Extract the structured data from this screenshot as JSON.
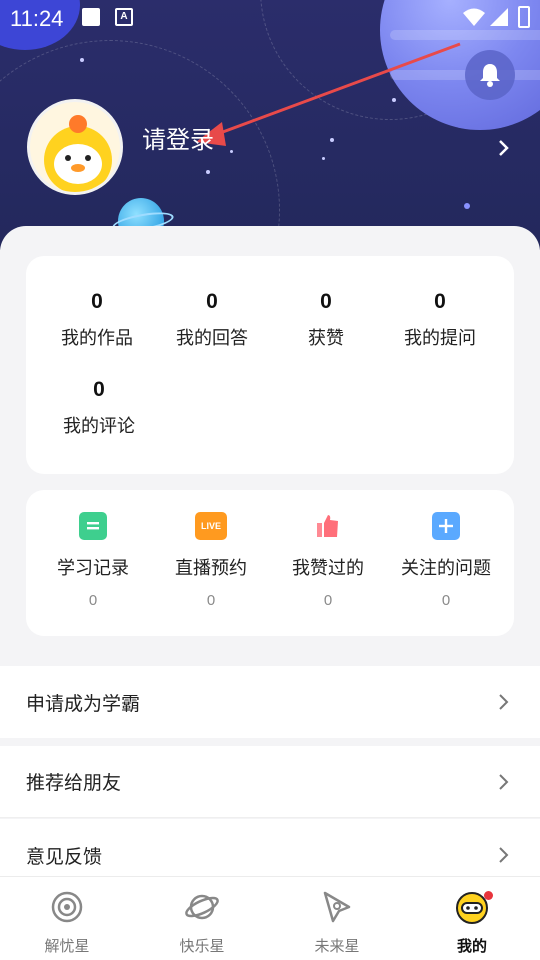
{
  "status_bar": {
    "time": "11:24",
    "badge_letter": "A"
  },
  "profile": {
    "login_text": "请登录"
  },
  "stats": [
    {
      "value": "0",
      "label": "我的作品"
    },
    {
      "value": "0",
      "label": "我的回答"
    },
    {
      "value": "0",
      "label": "获赞"
    },
    {
      "value": "0",
      "label": "我的提问"
    },
    {
      "value": "0",
      "label": "我的评论"
    }
  ],
  "shortcuts": [
    {
      "icon": "study-record-icon",
      "label": "学习记录",
      "count": "0",
      "color": "#3ecf8e"
    },
    {
      "icon": "live-reservation-icon",
      "label": "直播预约",
      "count": "0",
      "color": "#ff9a1f"
    },
    {
      "icon": "thumbs-up-icon",
      "label": "我赞过的",
      "count": "0",
      "color": "#ff6f7a"
    },
    {
      "icon": "plus-icon",
      "label": "关注的问题",
      "count": "0",
      "color": "#5aa9ff"
    }
  ],
  "shortcut_live_text": "LIVE",
  "menu": [
    {
      "label": "申请成为学霸"
    },
    {
      "label": "推荐给朋友"
    },
    {
      "label": "意见反馈"
    }
  ],
  "tabs": [
    {
      "label": "解忧星",
      "icon": "planet-spiral-icon",
      "active": false
    },
    {
      "label": "快乐星",
      "icon": "planet-ring-icon",
      "active": false
    },
    {
      "label": "未来星",
      "icon": "rocket-icon",
      "active": false
    },
    {
      "label": "我的",
      "icon": "astronaut-icon",
      "active": true
    }
  ],
  "colors": {
    "header_bg": "#2b2d6b",
    "annotation_arrow": "#e84a4a",
    "notification_dot": "#e8343c"
  }
}
